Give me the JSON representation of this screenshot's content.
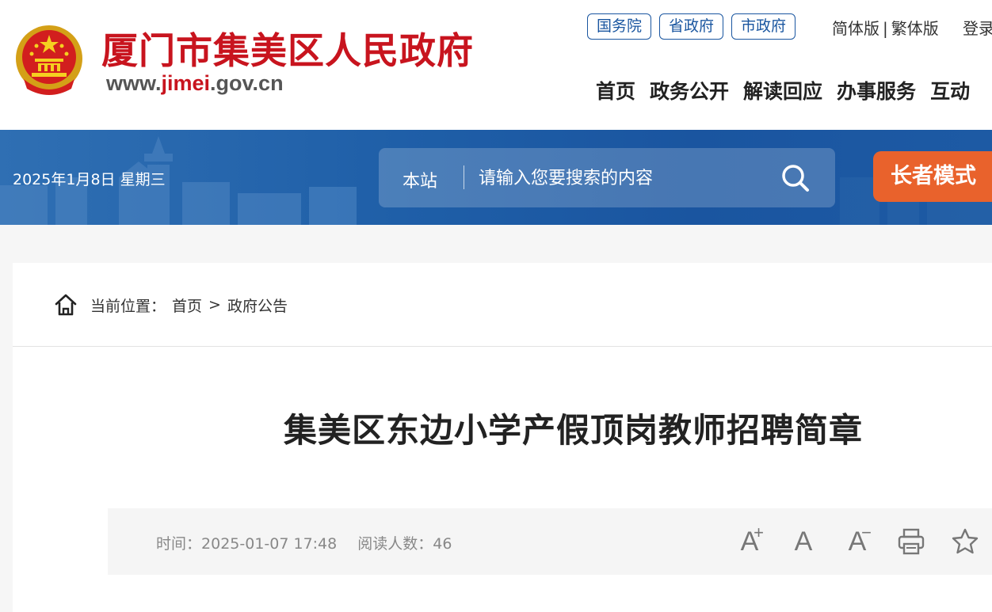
{
  "header": {
    "site_title": "厦门市集美区人民政府",
    "site_url_prefix": "www.",
    "site_url_highlight": "jimei",
    "site_url_suffix": ".gov.cn",
    "gov_links": [
      "国务院",
      "省政府",
      "市政府"
    ],
    "lang_simplified": "简体版",
    "lang_separator": "|",
    "lang_traditional": "繁体版",
    "login": "登录",
    "nav": [
      "首页",
      "政务公开",
      "解读回应",
      "办事服务",
      "互动"
    ]
  },
  "banner": {
    "date": "2025年1月8日 星期三",
    "search_scope": "本站",
    "search_placeholder": "请输入您要搜索的内容",
    "elder_mode": "长者模式"
  },
  "breadcrumb": {
    "label": "当前位置：",
    "home": "首页",
    "separator": ">",
    "current": "政府公告"
  },
  "article": {
    "title": "集美区东边小学产假顶岗教师招聘简章",
    "time_label": "时间：",
    "time_value": "2025-01-07 17:48",
    "reads_label": "阅读人数：",
    "reads_value": "46"
  },
  "tools": {
    "font_larger": "A",
    "font_larger_mark": "+",
    "font_default": "A",
    "font_smaller": "A",
    "font_smaller_mark": "−"
  },
  "colors": {
    "brand_red": "#c8141e",
    "brand_blue": "#1a56a0",
    "elder_orange": "#e9622c"
  },
  "icons": [
    "national-emblem-icon",
    "search-icon",
    "home-icon",
    "font-larger-icon",
    "font-default-icon",
    "font-smaller-icon",
    "print-icon",
    "favorite-star-icon"
  ]
}
